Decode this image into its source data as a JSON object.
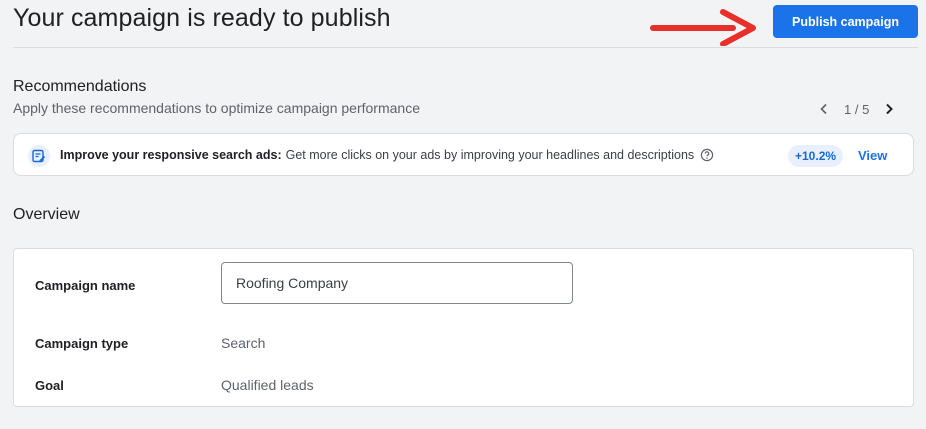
{
  "header": {
    "title": "Your campaign is ready to publish",
    "publish_label": "Publish campaign",
    "annotation_color": "#e8302a"
  },
  "recommendations": {
    "title": "Recommendations",
    "subtitle": "Apply these recommendations to optimize campaign performance",
    "pager": {
      "current": "1",
      "total": "5",
      "text": "1 / 5"
    },
    "card": {
      "icon": "ad-edit-icon",
      "heading": "Improve your responsive search ads:",
      "description": "Get more clicks on your ads by improving your headlines and descriptions",
      "uplift": "+10.2%",
      "action_label": "View"
    }
  },
  "overview": {
    "title": "Overview",
    "campaign_name": {
      "label": "Campaign name",
      "value": "Roofing Company"
    },
    "campaign_type": {
      "label": "Campaign type",
      "value": "Search"
    },
    "goal": {
      "label": "Goal",
      "value": "Qualified leads"
    }
  },
  "colors": {
    "primary": "#1a73e8",
    "background": "#f1f3f4",
    "card": "#ffffff"
  }
}
